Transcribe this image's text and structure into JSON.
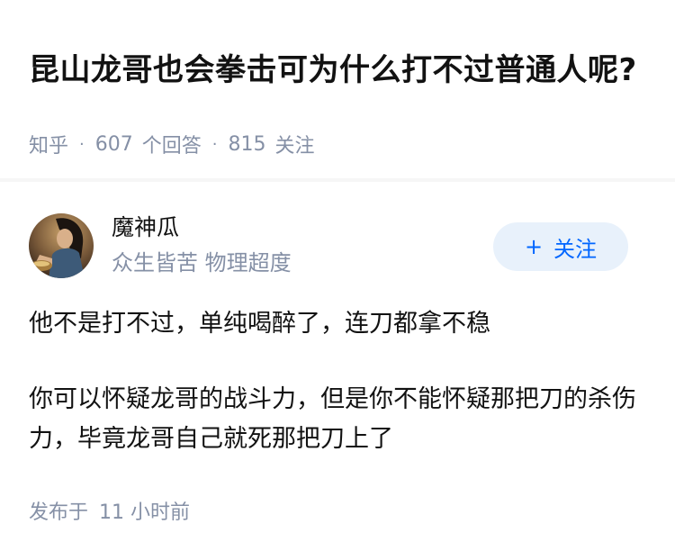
{
  "question": {
    "title": "昆山龙哥也会拳击可为什么打不过普通人呢?",
    "source": "知乎",
    "answer_count": "607",
    "answer_count_label": "个回答",
    "follower_count": "815",
    "follower_count_label": "关注",
    "separator": "·"
  },
  "author": {
    "name": "魔神瓜",
    "bio": "众生皆苦 物理超度",
    "follow_label": "关注",
    "follow_icon": "+"
  },
  "answer": {
    "paragraphs": [
      "他不是打不过，单纯喝醉了，连刀都拿不稳",
      "你可以怀疑龙哥的战斗力，但是你不能怀疑那把刀的杀伤力，毕竟龙哥自己就死那把刀上了"
    ],
    "publish_label": "发布于",
    "publish_time": "11 小时前"
  },
  "colors": {
    "text_primary": "#121212",
    "text_secondary": "#8590a6",
    "accent_blue": "#0066ff",
    "follow_bg": "#e8f1fb"
  }
}
